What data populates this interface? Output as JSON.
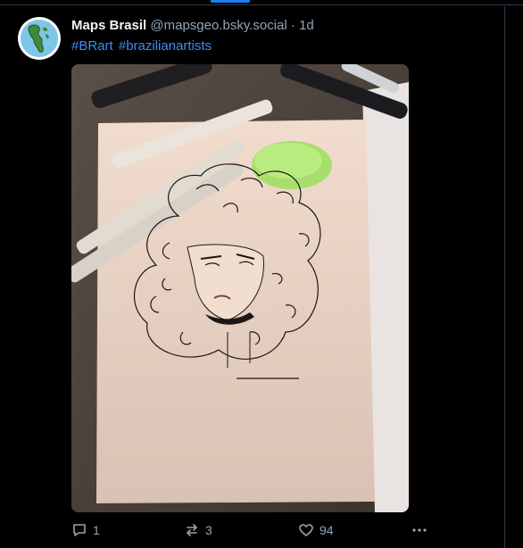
{
  "post": {
    "author_name": "Maps Brasil",
    "author_handle": "@mapsgeo.bsky.social",
    "separator": "·",
    "time": "1d",
    "hashtags": [
      "#BRart",
      "#brazilianartists"
    ]
  },
  "media": {
    "icon": "artwork-photo"
  },
  "actions": {
    "reply_count": "1",
    "repost_count": "3",
    "like_count": "94"
  },
  "colors": {
    "accent": "#3b8ef3",
    "muted": "#93a5b7",
    "background": "#000000"
  }
}
